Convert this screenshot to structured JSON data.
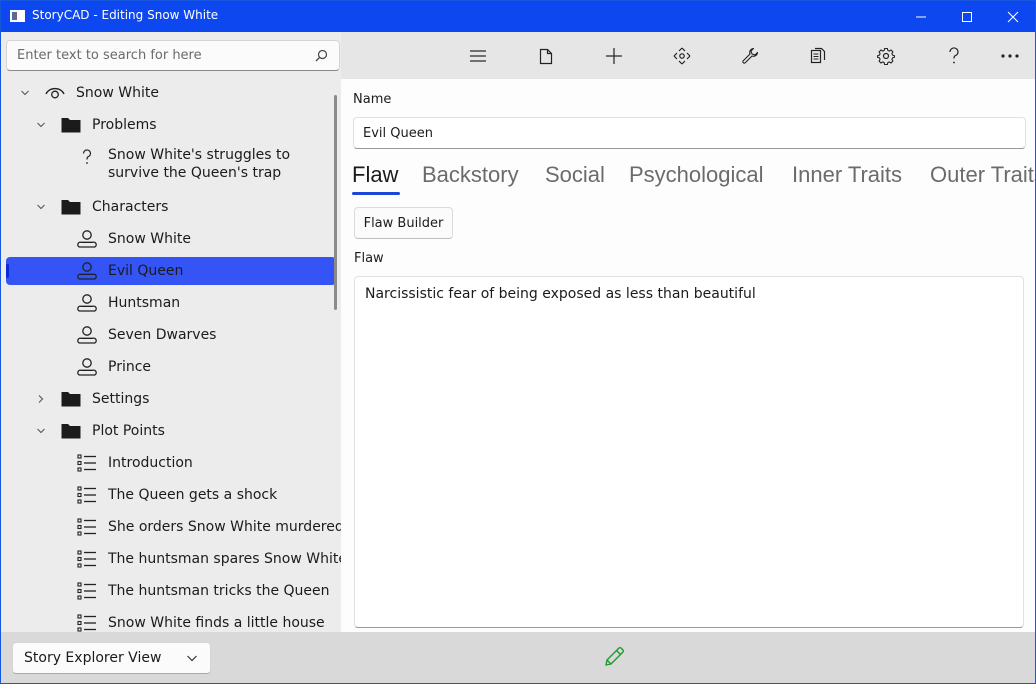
{
  "window": {
    "title": "StoryCAD - Editing Snow White"
  },
  "search": {
    "placeholder": "Enter text to search for here"
  },
  "tree": {
    "items": [
      {
        "label": "Snow White",
        "icon": "eye-icon",
        "level": 0,
        "expanded": true
      },
      {
        "label": "Problems",
        "icon": "folder-icon",
        "level": 1,
        "expanded": true
      },
      {
        "label": "Snow White's struggles to survive the Queen's trap",
        "icon": "question-icon",
        "level": 2
      },
      {
        "label": "Characters",
        "icon": "folder-icon",
        "level": 1,
        "expanded": true
      },
      {
        "label": "Snow White",
        "icon": "person-icon",
        "level": 2
      },
      {
        "label": "Evil Queen",
        "icon": "person-icon",
        "level": 2,
        "selected": true
      },
      {
        "label": "Huntsman",
        "icon": "person-icon",
        "level": 2
      },
      {
        "label": "Seven Dwarves",
        "icon": "person-icon",
        "level": 2
      },
      {
        "label": "Prince",
        "icon": "person-icon",
        "level": 2
      },
      {
        "label": "Settings",
        "icon": "folder-icon",
        "level": 1,
        "expanded": false
      },
      {
        "label": "Plot Points",
        "icon": "folder-icon",
        "level": 1,
        "expanded": true
      },
      {
        "label": "Introduction",
        "icon": "list-icon",
        "level": 2
      },
      {
        "label": "The Queen gets a shock",
        "icon": "list-icon",
        "level": 2
      },
      {
        "label": "She orders Snow White murdered",
        "icon": "list-icon",
        "level": 2
      },
      {
        "label": "The huntsman spares Snow White",
        "icon": "list-icon",
        "level": 2
      },
      {
        "label": "The huntsman tricks the Queen",
        "icon": "list-icon",
        "level": 2
      },
      {
        "label": "Snow White finds a little house",
        "icon": "list-icon",
        "level": 2
      }
    ]
  },
  "toolbar": {
    "icons": [
      "menu-icon",
      "file-icon",
      "add-icon",
      "move-icon",
      "wrench-icon",
      "copy-icon",
      "gear-icon",
      "help-icon",
      "more-icon"
    ]
  },
  "content": {
    "name_label": "Name",
    "name_value": "Evil Queen",
    "tabs": [
      "Flaw",
      "Backstory",
      "Social",
      "Psychological",
      "Inner Traits",
      "Outer Traits"
    ],
    "active_tab": "Flaw",
    "flaw_builder_label": "Flaw Builder",
    "flaw_label": "Flaw",
    "flaw_value": "Narcissistic fear of being exposed as less than beautiful"
  },
  "statusbar": {
    "view_selected": "Story Explorer View",
    "edit_indicator_icon": "pencil-icon"
  },
  "colors": {
    "titlebar": "#0d47f0",
    "selection": "#3554f5",
    "tab_underline": "#1a47d8",
    "pencil": "#1f9a2e"
  }
}
